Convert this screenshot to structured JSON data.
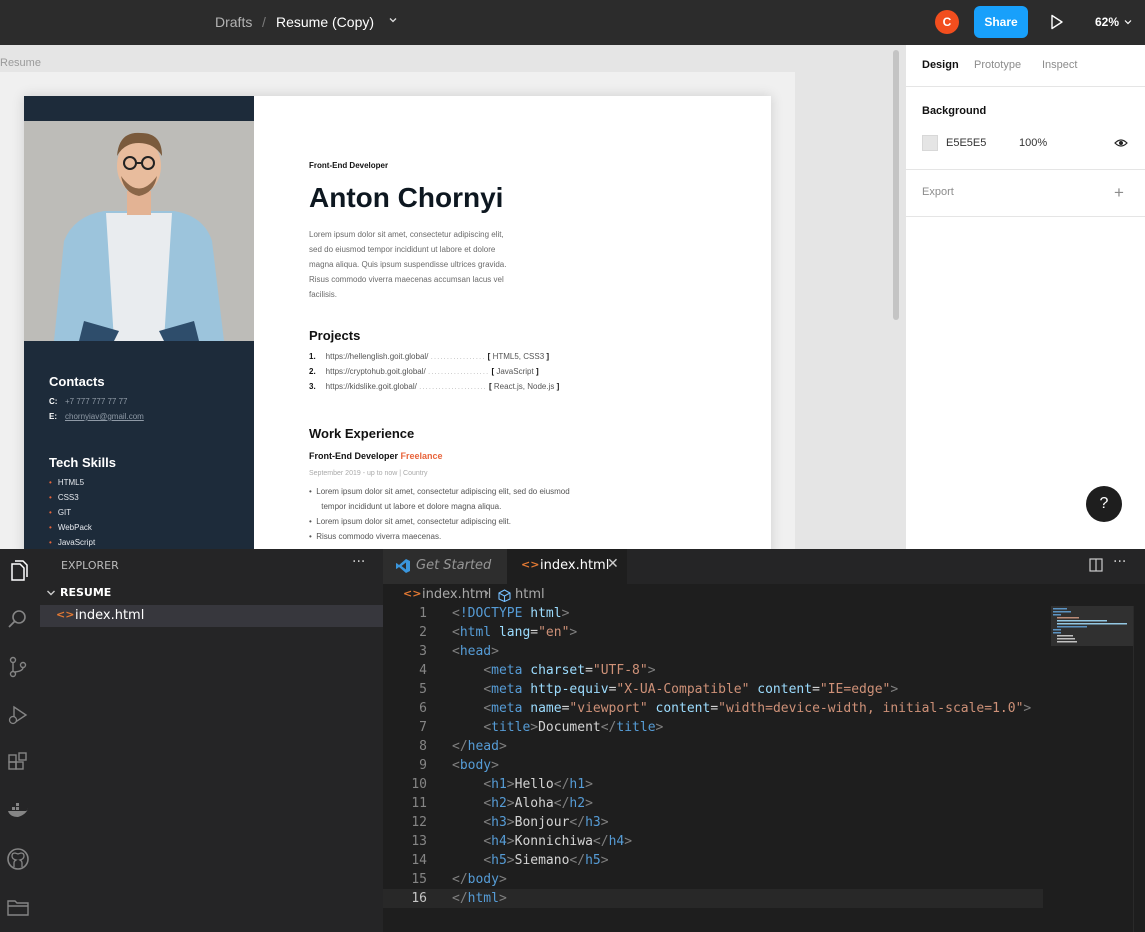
{
  "figma": {
    "breadcrumb": {
      "drafts": "Drafts",
      "separator": "/",
      "file": "Resume (Copy)"
    },
    "avatar_letter": "C",
    "share_label": "Share",
    "zoom": "62%",
    "frame_label": "Resume",
    "panel": {
      "tabs": [
        "Design",
        "Prototype",
        "Inspect"
      ],
      "background_title": "Background",
      "background_hex": "E5E5E5",
      "background_opacity": "100%",
      "export_title": "Export",
      "export_add": "+",
      "help": "?"
    },
    "resume": {
      "role": "Front-End Developer",
      "name": "Anton Chornyi",
      "bio": [
        "Lorem ipsum dolor sit amet, consectetur adipiscing elit,",
        "sed do eiusmod tempor incididunt ut labore et dolore",
        "magna aliqua. Quis ipsum suspendisse ultrices gravida.",
        "Risus commodo viverra maecenas accumsan lacus vel",
        "facilisis."
      ],
      "projects_title": "Projects",
      "projects": [
        {
          "num": "1.",
          "url": "https://hellenglish.goit.global/",
          "tags": "HTML5, CSS3"
        },
        {
          "num": "2.",
          "url": "https://cryptohub.goit.global/",
          "tags": "JavaScript"
        },
        {
          "num": "3.",
          "url": "https://kidslike.goit.global/",
          "tags": "React.js, Node.js"
        }
      ],
      "work_title": "Work Experience",
      "job_title": "Front-End Developer",
      "job_type": "Freelance",
      "job_meta": "September 2019 - up to now  |  Country",
      "job_bullets": [
        "Lorem ipsum dolor sit amet, consectetur adipiscing elit, sed do eiusmod",
        "tempor incididunt ut labore et dolore magna aliqua.",
        "Lorem ipsum dolor sit amet, consectetur adipiscing elit.",
        "Risus commodo viverra maecenas."
      ],
      "contacts_title": "Contacts",
      "contact_phone_label": "C:",
      "contact_phone": "+7 777 777 77 77",
      "contact_email_label": "E:",
      "contact_email": "chornyiav@gmail.com",
      "skills_title": "Tech Skills",
      "skills": [
        "HTML5",
        "CSS3",
        "GIT",
        "WebPack",
        "JavaScript"
      ]
    }
  },
  "vscode": {
    "explorer_title": "EXPLORER",
    "more": "···",
    "folder": "RESUME",
    "file": "index.html",
    "tabs": {
      "get_started": "Get Started",
      "index": "index.html",
      "close": "✕"
    },
    "breadcrumb": {
      "file": "index.html",
      "separator": "›",
      "symbol": "html"
    },
    "active_line": 16
  }
}
